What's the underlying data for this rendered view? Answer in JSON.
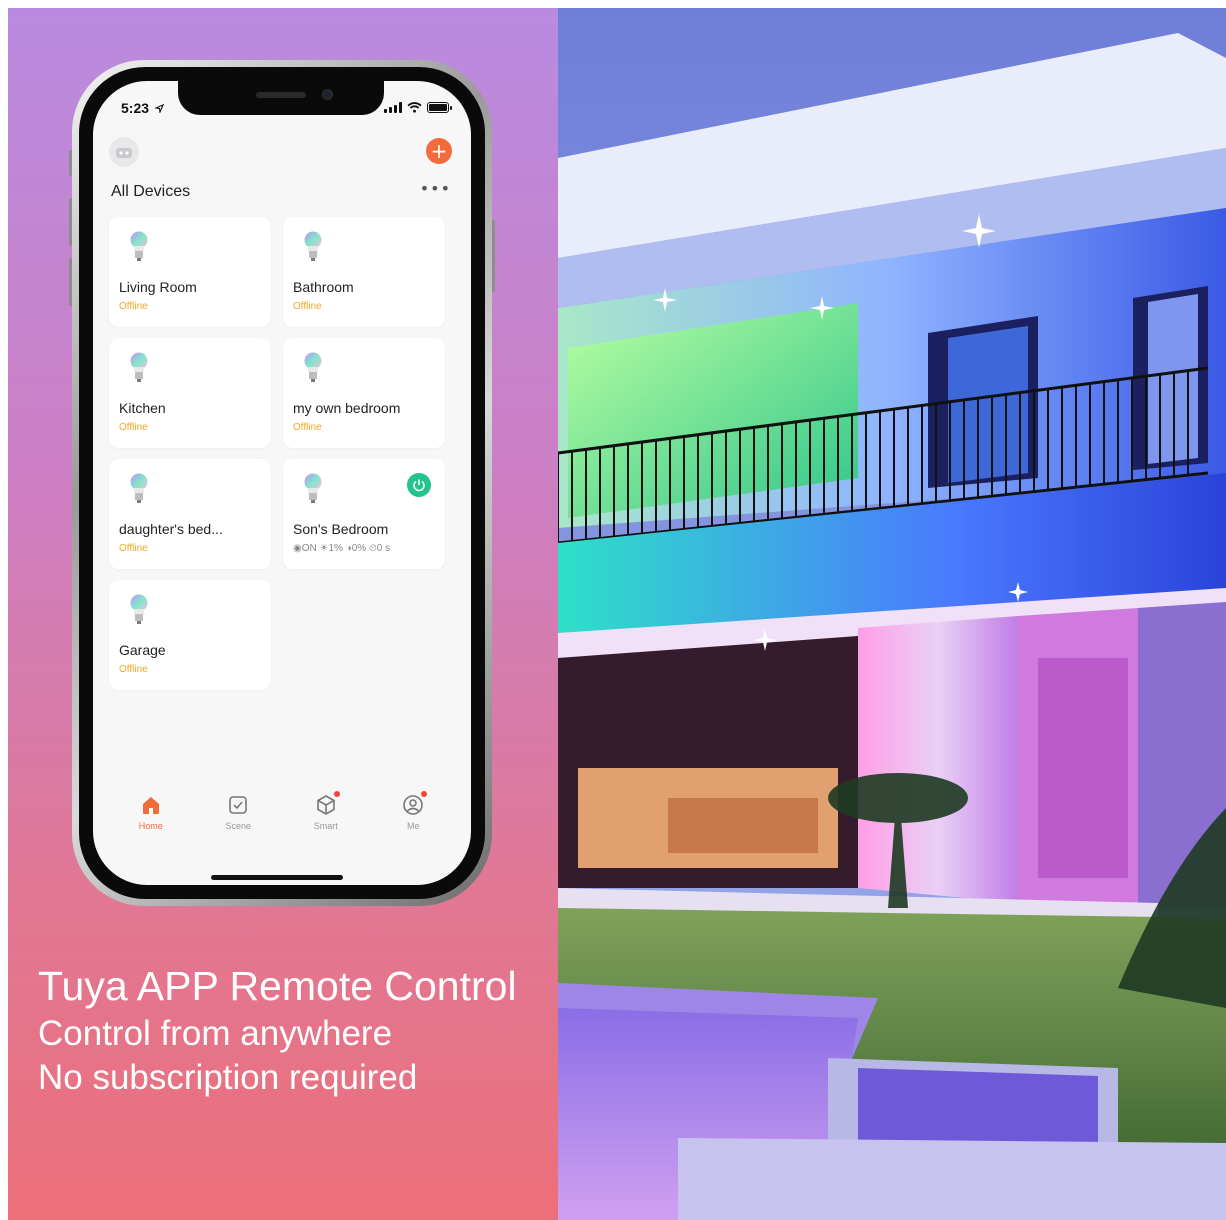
{
  "status_bar": {
    "time": "5:23"
  },
  "header": {
    "title": "All Devices",
    "add_icon": "plus-icon",
    "more_icon": "ellipsis-icon"
  },
  "devices": [
    {
      "name": "Living Room",
      "status": "Offline"
    },
    {
      "name": "Bathroom",
      "status": "Offline"
    },
    {
      "name": "Kitchen",
      "status": "Offline"
    },
    {
      "name": "my own bedroom",
      "status": "Offline"
    },
    {
      "name": "daughter's bed...",
      "status": "Offline"
    },
    {
      "name": "Son's Bedroom",
      "status": "◉ON  ☀1%  ◑0%  ⏲0 s"
    },
    {
      "name": "Garage",
      "status": "Offline"
    }
  ],
  "tabs": [
    {
      "label": "Home",
      "icon": "home-icon"
    },
    {
      "label": "Scene",
      "icon": "scene-checkbox-icon"
    },
    {
      "label": "Smart",
      "icon": "smart-cube-icon"
    },
    {
      "label": "Me",
      "icon": "profile-icon"
    }
  ],
  "promo": {
    "line1": "Tuya APP Remote Control",
    "line2": "Control from anywhere",
    "line3": "No subscription required"
  },
  "colors": {
    "accent": "#f26b3a",
    "offline": "#f5a623",
    "power_on": "#22c38e",
    "gradient_top": "#b98be0",
    "gradient_bottom": "#ec6f79"
  }
}
